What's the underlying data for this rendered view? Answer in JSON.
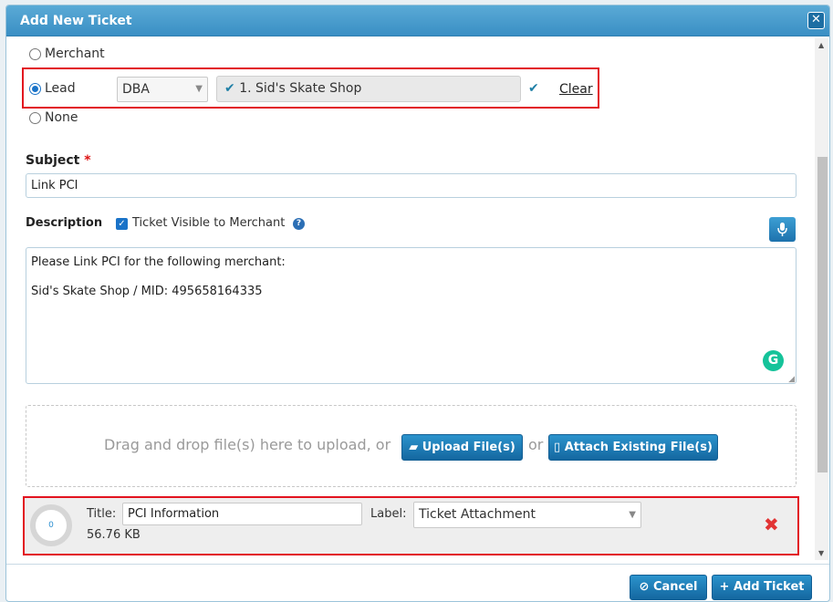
{
  "dialog": {
    "title": "Add New Ticket",
    "close_icon": "close-icon"
  },
  "account_type": {
    "options": [
      "Merchant",
      "Lead",
      "None"
    ],
    "selected": "Lead",
    "search_field": "DBA",
    "lead_value": "1. Sid's Skate Shop",
    "clear_label": "Clear"
  },
  "subject": {
    "label": "Subject",
    "required_mark": "*",
    "value": "Link PCI"
  },
  "description": {
    "label": "Description",
    "visible_to_merchant_label": "Ticket Visible to Merchant",
    "visible_to_merchant": true,
    "help_icon": "?",
    "line1": "Please Link PCI for the following merchant:",
    "line2": "Sid's Skate Shop / MID: 495658164335"
  },
  "upload": {
    "prompt": "Drag and drop file(s) here to upload, or",
    "upload_label": "Upload File(s)",
    "or_label": "or",
    "attach_label": "Attach Existing File(s)"
  },
  "attachment": {
    "progress": "0",
    "title_label": "Title:",
    "title_value": "PCI Information",
    "size": "56.76 KB",
    "label_label": "Label:",
    "label_value": "Ticket Attachment"
  },
  "footer": {
    "cancel_label": "Cancel",
    "add_label": "Add Ticket"
  },
  "colors": {
    "accent": "#1a73c8",
    "highlight_border": "#e2121f",
    "button": "#1d72ad"
  }
}
